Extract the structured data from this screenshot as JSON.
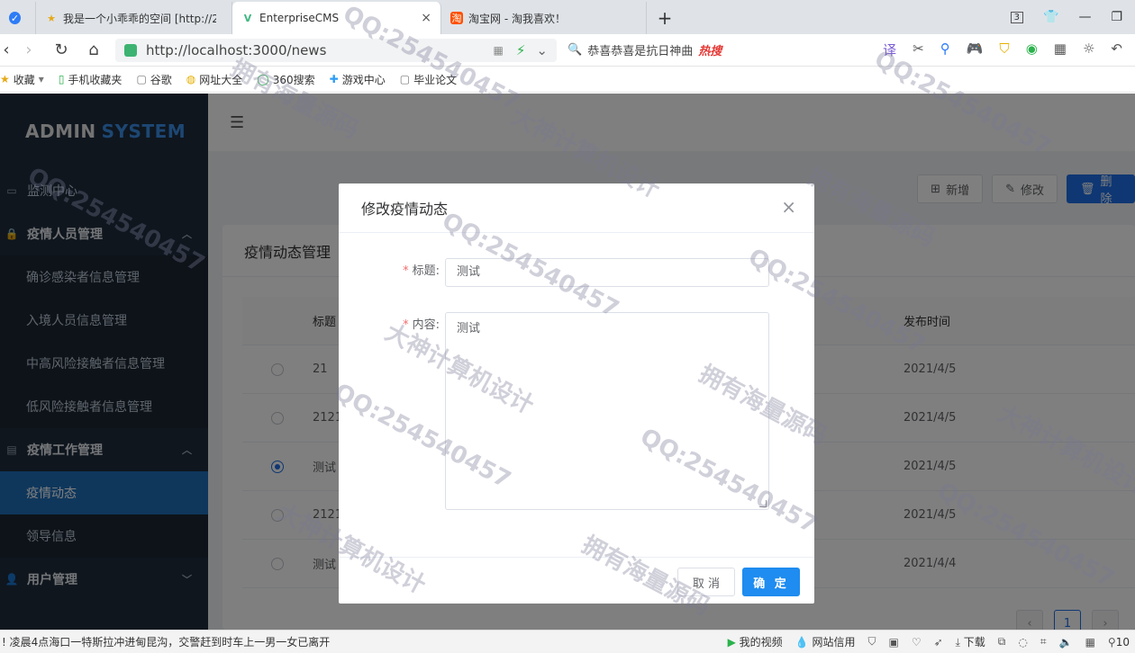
{
  "browser": {
    "tabs": [
      {
        "label": "我是一个小乖乖的空间 [http://2",
        "icon": "star-icon",
        "active": false
      },
      {
        "label": "EnterpriseCMS",
        "icon": "vue-logo-icon",
        "active": true
      },
      {
        "label": "淘宝网 - 淘我喜欢！",
        "icon": "taobao-icon",
        "active": false
      }
    ],
    "new_tab": "+",
    "tab_count": "3",
    "url": "http://localhost:3000/news",
    "search_hint": "恭喜恭喜是抗日神曲",
    "hot_label": "热搜",
    "bookmarks": [
      {
        "label": "收藏"
      },
      {
        "label": "手机收藏夹"
      },
      {
        "label": "谷歌"
      },
      {
        "label": "网址大全"
      },
      {
        "label": "360搜索"
      },
      {
        "label": "游戏中心"
      },
      {
        "label": "毕业论文"
      }
    ]
  },
  "sidebar": {
    "logo_prefix": "ADMIN",
    "logo_suffix": "SYSTEM",
    "items": [
      {
        "label": "监测中心",
        "type": "item"
      },
      {
        "label": "疫情人员管理",
        "type": "group"
      },
      {
        "label": "确诊感染者信息管理",
        "type": "sub"
      },
      {
        "label": "入境人员信息管理",
        "type": "sub"
      },
      {
        "label": "中高风险接触者信息管理",
        "type": "sub"
      },
      {
        "label": "低风险接触者信息管理",
        "type": "sub"
      },
      {
        "label": "疫情工作管理",
        "type": "group"
      },
      {
        "label": "疫情动态",
        "type": "sub-active"
      },
      {
        "label": "领导信息",
        "type": "sub"
      },
      {
        "label": "用户管理",
        "type": "group-collapsed"
      }
    ]
  },
  "toolbar": {
    "add_label": "新增",
    "edit_label": "修改",
    "delete_label": "删除"
  },
  "card": {
    "title": "疫情动态管理",
    "columns": {
      "title": "标题",
      "time": "发布时间"
    },
    "rows": [
      {
        "title": "21",
        "time": "2021/4/5",
        "selected": false
      },
      {
        "title": "2121",
        "time": "2021/4/5",
        "selected": false
      },
      {
        "title": "测试",
        "time": "2021/4/5",
        "selected": true
      },
      {
        "title": "2121",
        "time": "2021/4/5",
        "selected": false
      },
      {
        "title": "测试",
        "time": "2021/4/4",
        "selected": false
      }
    ],
    "pagination": {
      "prev": "‹",
      "current": "1",
      "next": "›"
    }
  },
  "dialog": {
    "title": "修改疫情动态",
    "close": "×",
    "title_label": "标题:",
    "title_value": "测试",
    "content_label": "内容:",
    "content_value": "测试",
    "cancel_label": "取 消",
    "ok_label": "确 定"
  },
  "statusbar": {
    "news": "! 凌晨4点海口一特斯拉冲进甸昆沟，交警赶到时车上一男一女已离开",
    "video": "我的视频",
    "credit": "网站信用",
    "download": "下载",
    "zoom": "10"
  },
  "watermarks": [
    "QQ:254540457",
    "大神计算机设计",
    "拥有海量源码"
  ],
  "colors": {
    "sidebar_bg": "#1f2d3d",
    "accent": "#1e6fe6",
    "active_menu": "#1e6fb8"
  }
}
